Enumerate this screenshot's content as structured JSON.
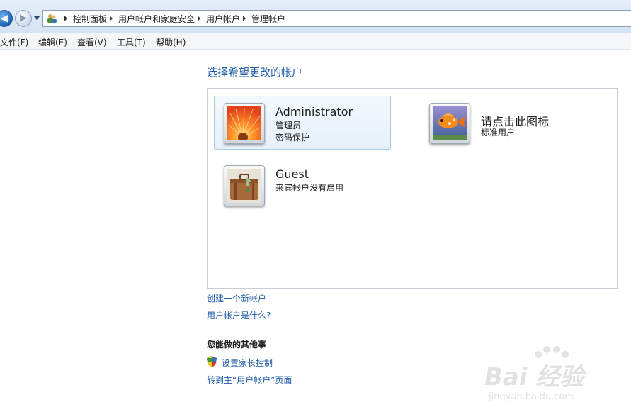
{
  "breadcrumb": [
    "控制面板",
    "用户帐户和家庭安全",
    "用户帐户",
    "管理帐户"
  ],
  "menu": [
    "文件(F)",
    "编辑(E)",
    "查看(V)",
    "工具(T)",
    "帮助(H)"
  ],
  "heading": "选择希望更改的帐户",
  "accounts": [
    {
      "name": "Administrator",
      "line1": "管理员",
      "line2": "密码保护",
      "picture": "orange-flower-picture"
    },
    {
      "name": "请点击此图标",
      "line1": "标准用户",
      "picture": "fish-picture"
    },
    {
      "name": "Guest",
      "line1": "来宾帐户没有启用",
      "picture": "suitcase-picture"
    }
  ],
  "links": {
    "create": "创建一个新帐户",
    "what_is": "用户帐户是什么?",
    "other_title": "您能做的其他事",
    "parental": "设置家长控制",
    "goto_main": "转到主“用户帐户”页面"
  },
  "watermark": {
    "main": "Bai 经验",
    "sub": "jingyan.baidu.com"
  },
  "colors": {
    "link": "#1e5aa8",
    "selected_bg": "#e6f0fa",
    "selected_border": "#a9cde8"
  }
}
